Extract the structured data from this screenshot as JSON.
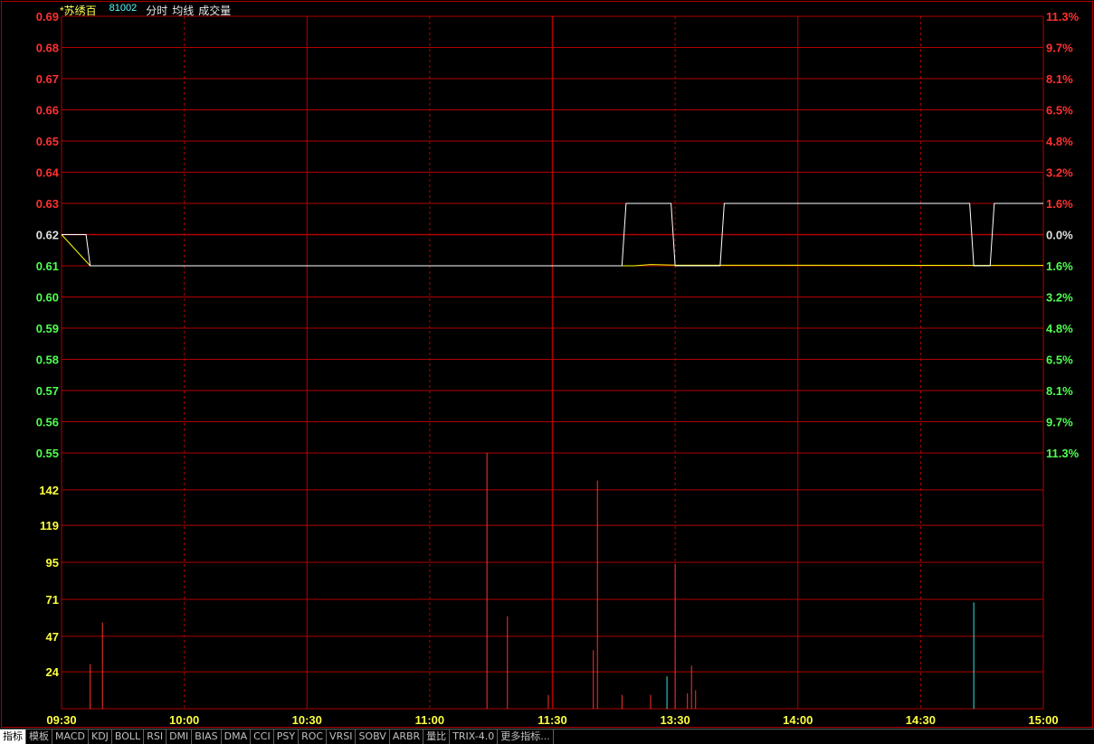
{
  "header": {
    "stock_name": "*苏绣百",
    "code": "81002",
    "items": [
      "分时",
      "均线",
      "成交量"
    ]
  },
  "colors": {
    "grid": "#b00000",
    "price_line": "#ffffff",
    "avg_line": "#ffff00",
    "up": "#ff3030",
    "down": "#50ff50",
    "neutral": "#e0e0e0",
    "volume_axis": "#ffff40",
    "volume_up": "#ff3030",
    "volume_down": "#40e0e0"
  },
  "chart_data": {
    "type": "line",
    "reference_price": 0.62,
    "price_ticks": [
      "0.69",
      "0.68",
      "0.67",
      "0.66",
      "0.65",
      "0.64",
      "0.63",
      "0.62",
      "0.61",
      "0.60",
      "0.59",
      "0.58",
      "0.57",
      "0.56",
      "0.55"
    ],
    "percent_ticks": [
      "11.3%",
      "9.7%",
      "8.1%",
      "6.5%",
      "4.8%",
      "3.2%",
      "1.6%",
      "0.0%",
      "1.6%",
      "3.2%",
      "4.8%",
      "6.5%",
      "8.1%",
      "9.7%",
      "11.3%"
    ],
    "ylim": [
      0.55,
      0.69
    ],
    "x_ticks": [
      "09:30",
      "10:00",
      "10:30",
      "11:00",
      "11:30",
      "13:30",
      "14:00",
      "14:30",
      "15:00"
    ],
    "time_range_minutes": 240,
    "price_series": {
      "x": [
        0,
        6,
        7,
        137,
        138,
        149,
        150,
        161,
        162,
        222,
        223,
        227,
        228,
        240
      ],
      "y": [
        0.62,
        0.62,
        0.61,
        0.61,
        0.63,
        0.63,
        0.61,
        0.61,
        0.63,
        0.63,
        0.61,
        0.61,
        0.63,
        0.63
      ]
    },
    "avg_series": {
      "x": [
        0,
        7,
        140,
        144,
        150,
        240
      ],
      "y": [
        0.62,
        0.61,
        0.61,
        0.6104,
        0.6102,
        0.6101
      ]
    },
    "volume": {
      "ticks": [
        "142",
        "119",
        "95",
        "71",
        "47",
        "24"
      ],
      "ylim": [
        0,
        166
      ],
      "bars": [
        {
          "t": 7,
          "v": 29,
          "dir": "up"
        },
        {
          "t": 10,
          "v": 56,
          "dir": "up"
        },
        {
          "t": 104,
          "v": 166,
          "dir": "up"
        },
        {
          "t": 109,
          "v": 60,
          "dir": "up"
        },
        {
          "t": 119,
          "v": 9,
          "dir": "up"
        },
        {
          "t": 130,
          "v": 38,
          "dir": "up"
        },
        {
          "t": 131,
          "v": 148,
          "dir": "up"
        },
        {
          "t": 137,
          "v": 9,
          "dir": "up"
        },
        {
          "t": 144,
          "v": 9,
          "dir": "up"
        },
        {
          "t": 148,
          "v": 21,
          "dir": "down"
        },
        {
          "t": 150,
          "v": 94,
          "dir": "up"
        },
        {
          "t": 153,
          "v": 10,
          "dir": "up"
        },
        {
          "t": 154,
          "v": 28,
          "dir": "up"
        },
        {
          "t": 155,
          "v": 12,
          "dir": "up"
        },
        {
          "t": 223,
          "v": 69,
          "dir": "down"
        }
      ]
    }
  },
  "tabs": [
    "指标",
    "模板",
    "MACD",
    "KDJ",
    "BOLL",
    "RSI",
    "DMI",
    "BIAS",
    "DMA",
    "CCI",
    "PSY",
    "ROC",
    "VRSI",
    "SOBV",
    "ARBR",
    "量比",
    "TRIX-4.0",
    "更多指标..."
  ],
  "active_tab": "指标"
}
